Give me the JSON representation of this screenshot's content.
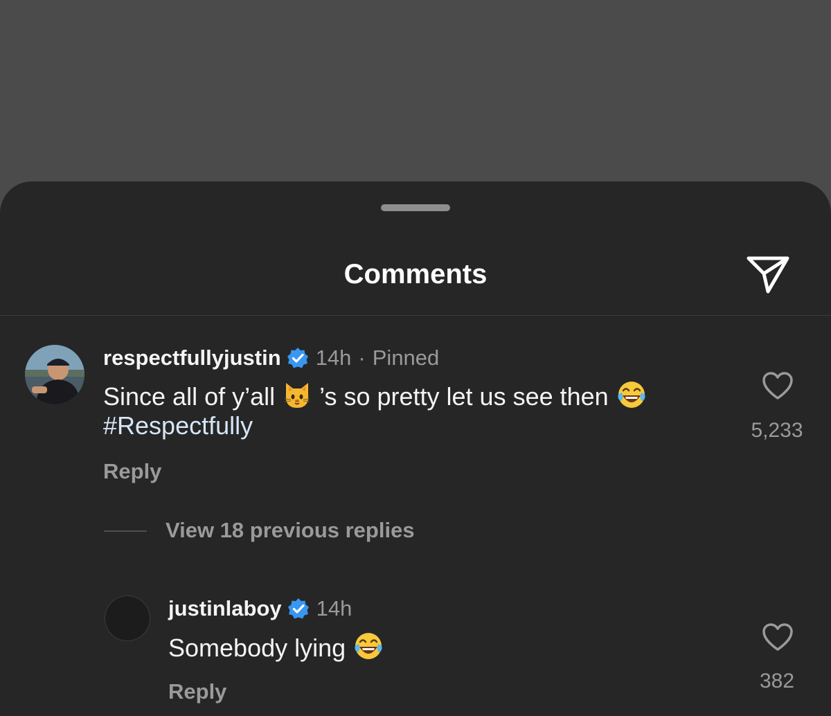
{
  "header": {
    "title": "Comments",
    "share_icon": "paper-plane-icon"
  },
  "comments": [
    {
      "username": "respectfullyjustin",
      "verified": true,
      "time": "14h",
      "separator": "·",
      "pinned_label": "Pinned",
      "text_part1": "Since all of y’all ",
      "emoji1": "cat-face-emoji",
      "text_part2": " ’s so pretty let us see then ",
      "emoji2": "tears-of-joy-emoji",
      "hashtag": "#Respectfully",
      "reply_label": "Reply",
      "like_count": "5,233"
    }
  ],
  "view_replies_label": "View 18 previous replies",
  "replies": [
    {
      "username": "justinlaboy",
      "verified": true,
      "time": "14h",
      "text": "Somebody lying ",
      "emoji": "tears-of-joy-emoji",
      "reply_label": "Reply",
      "like_count": "382"
    }
  ],
  "colors": {
    "backdrop": "#4b4b4b",
    "sheet": "#262626",
    "verified_badge": "#3897f0",
    "secondary_text": "#9a9a9a",
    "hashtag": "#d6e6f7"
  }
}
